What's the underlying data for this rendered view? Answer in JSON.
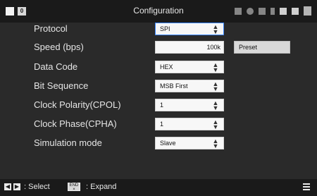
{
  "header": {
    "title": "Configuration",
    "badge": "0",
    "status_icons": [
      "printer-icon",
      "wifi-icon",
      "network-icon",
      "usb-icon",
      "settings-icon",
      "sd-card-icon",
      "battery-icon"
    ]
  },
  "settings": {
    "protocol": {
      "label": "Protocol",
      "value": "SPI"
    },
    "speed": {
      "label": "Speed (bps)",
      "value": "100k",
      "preset": "Preset"
    },
    "data_code": {
      "label": "Data Code",
      "value": "HEX"
    },
    "bit_sequence": {
      "label": "Bit Sequence",
      "value": "MSB First"
    },
    "cpol": {
      "label": "Clock Polarity(CPOL)",
      "value": "1"
    },
    "cpha": {
      "label": "Clock Phase(CPHA)",
      "value": "1"
    },
    "simulation_mode": {
      "label": "Simulation mode",
      "value": "Slave"
    }
  },
  "footer": {
    "select_hint": ": Select",
    "expand_hint": ": Expand",
    "end_key": "END\n×"
  },
  "colors": {
    "accent": "#3a86ff",
    "background": "#2a2a2a",
    "bar": "#1a1a1a"
  }
}
